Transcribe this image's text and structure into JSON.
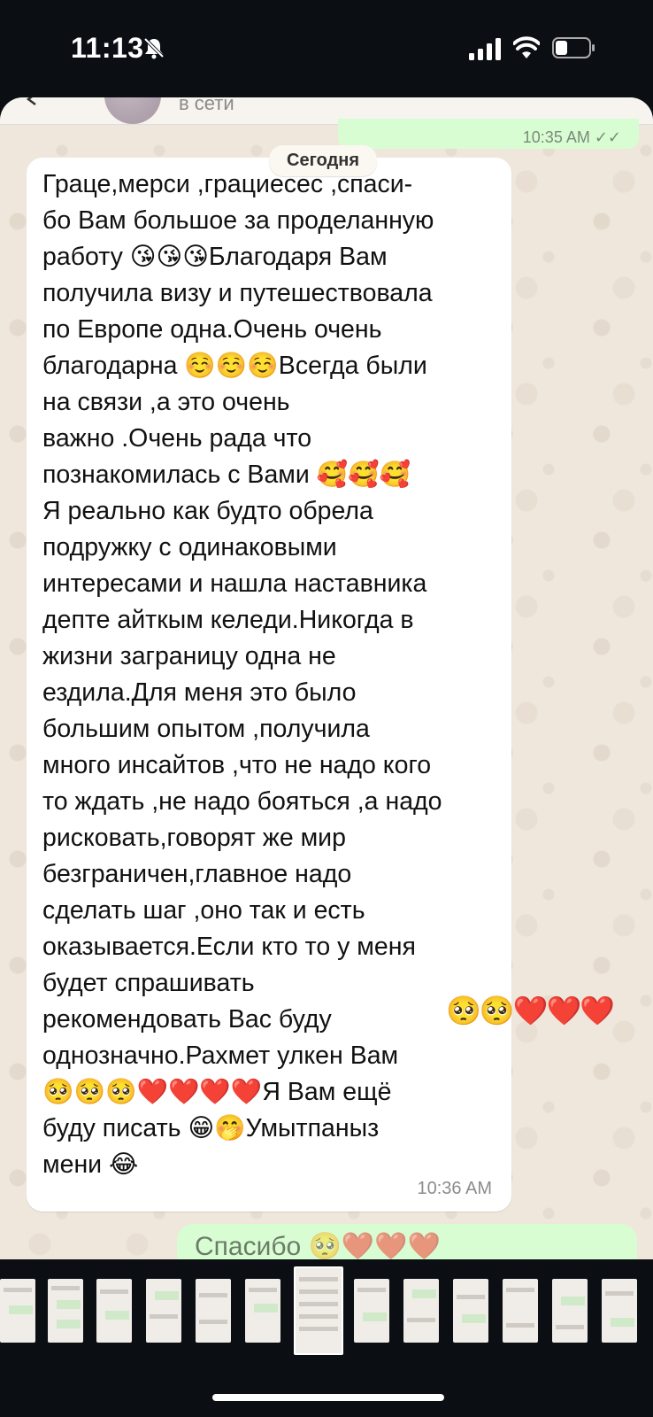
{
  "status_bar": {
    "time": "11:13"
  },
  "chat": {
    "header_status": "в сети",
    "prev_time_fragment": "10:35 AM ✓✓",
    "date_pill": "Сегодня",
    "message": {
      "text": "Граце,мерси ,грациесес ,спаси-\nбо Вам большое за проделанную\nработу 😘😘😘Благодаря Вам\nполучила визу и путешествовала\nпо Европе одна.Очень очень\nблагодарна ☺️☺️☺️Всегда были\nна связи ,а это очень\nважно .Очень рада что\nпознакомилась с Вами  🥰🥰🥰\nЯ реально как будто обрела\nподружку с одинаковыми\nинтересами и нашла наставника\nдепте айткым келеди.Никогда в\nжизни заграницу одна не\nездила.Для меня это было\nбольшим опытом ,получила\nмного инсайтов ,что не надо кого\nто ждать ,не надо бояться ,а надо\nрисковать,говорят же мир\nбезграничен,главное надо\nсделать шаг ,оно так и есть\nоказывается.Если кто то у меня\nбудет спрашивать\nрекомендовать Вас буду\nоднозначно.Рахмет улкен Вам\n🥺🥺🥺❤️❤️❤️❤️Я Вам ещё\nбуду писать 😁🤭Умытпаныз\nмени 😂",
      "overflow_emoji": "🥺🥺❤️❤️❤️",
      "time": "10:36 AM"
    },
    "next_message_fragment": "Спасибо 🥺❤️❤️❤️"
  },
  "gallery": {
    "thumbnail_count": 13,
    "active_index": 6
  }
}
